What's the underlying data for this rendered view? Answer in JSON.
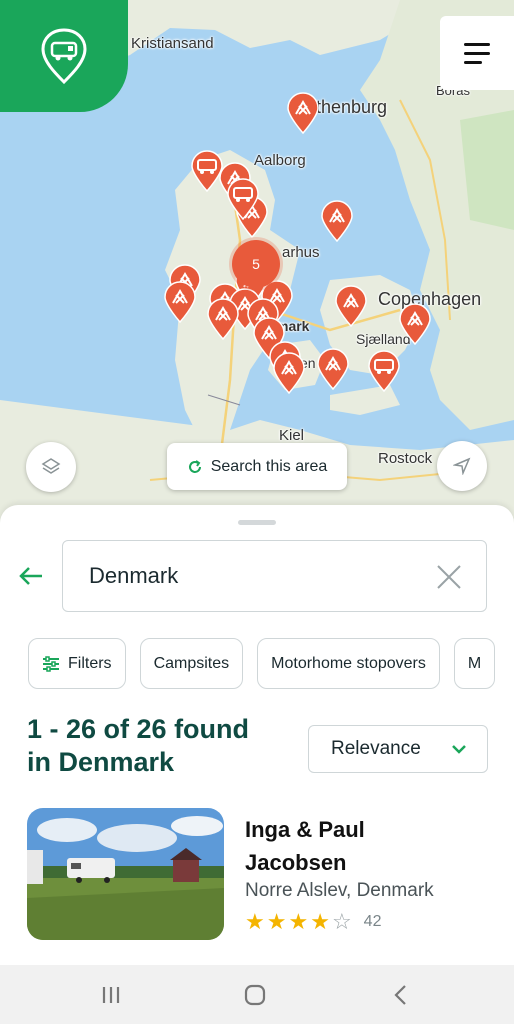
{
  "map": {
    "labels": {
      "kristiansand": "Kristiansand",
      "gothenburg": "thenburg",
      "boras": "Borås",
      "aalborg": "Aalborg",
      "aarhus": "arhus",
      "copenhagen": "Copenhagen",
      "denmark": "mark",
      "sjaelland": "Sjælland",
      "odense": "en",
      "kiel": "Kiel",
      "rostock": "Rostock"
    },
    "cluster_count": "5",
    "search_area_label": "Search this area",
    "pin_color": "#e85a3b",
    "brand_color": "#1aa65a",
    "icons": {
      "logo": "campervan-logo-icon",
      "menu": "hamburger-menu-icon",
      "layers": "layers-icon",
      "locate": "location-arrow-icon",
      "refresh": "refresh-icon"
    }
  },
  "search": {
    "back_icon": "back-arrow-icon",
    "value": "Denmark",
    "clear_icon": "close-icon"
  },
  "filters": {
    "filters_label": "Filters",
    "filters_icon": "sliders-icon",
    "chips": [
      "Campsites",
      "Motorhome stopovers",
      "M"
    ]
  },
  "results": {
    "title_line1": "1 - 26 of 26 found",
    "title_line2": "in Denmark",
    "sort_label": "Relevance",
    "sort_icon": "chevron-down-icon"
  },
  "listing": {
    "name_line1": "Inga & Paul",
    "name_line2": "Jacobsen",
    "location": "Norre Alslev, Denmark",
    "rating": 4.5,
    "review_count": "42"
  },
  "navbar": {
    "icons": [
      "recent-apps-icon",
      "home-icon",
      "back-icon"
    ]
  }
}
